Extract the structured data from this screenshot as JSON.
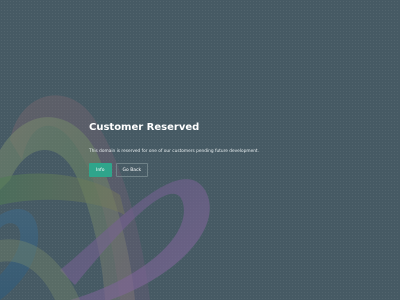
{
  "page": {
    "title": "Customer Reserved",
    "description": "This domain is reserved for one of our customers pending future development."
  },
  "actions": {
    "primary_label": "Info",
    "secondary_label": "Go Back"
  },
  "colors": {
    "background": "#465a64",
    "primary_button": "#2fa58b",
    "text": "#ffffff"
  }
}
